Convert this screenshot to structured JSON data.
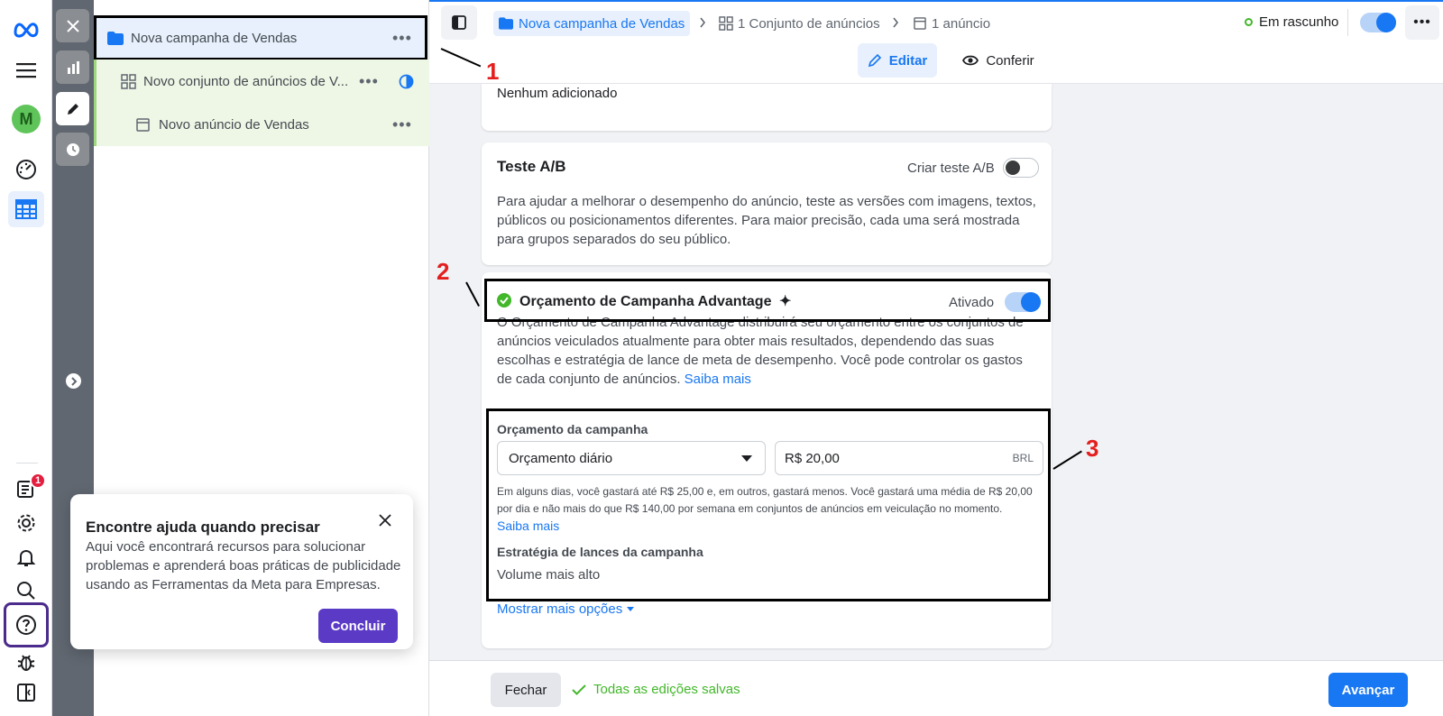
{
  "breadcrumb": {
    "campaign": "Nova campanha de Vendas",
    "adset": "1 Conjunto de anúncios",
    "ad": "1 anúncio"
  },
  "status": {
    "label": "Em rascunho",
    "toggle_on": true
  },
  "mode_tabs": {
    "edit": "Editar",
    "review": "Conferir"
  },
  "tree": {
    "campaign": "Nova campanha de Vendas",
    "adset": "Novo conjunto de anúncios de V...",
    "ad": "Novo anúncio de Vendas"
  },
  "prev_section": {
    "text": "Nenhum adicionado"
  },
  "ab_test": {
    "title": "Teste A/B",
    "toggle_label": "Criar teste A/B",
    "toggle_on": false,
    "description": "Para ajudar a melhorar o desempenho do anúncio, teste as versões com imagens, textos, públicos ou posicionamentos diferentes. Para maior precisão, cada uma será mostrada para grupos separados do seu público."
  },
  "advantage": {
    "title": "Orçamento de Campanha Advantage",
    "sparkle": "✦",
    "toggle_label": "Ativado",
    "toggle_on": true,
    "description": "O Orçamento de Campanha Advantage distribuirá seu orçamento entre os conjuntos de anúncios veiculados atualmente para obter mais resultados, dependendo das suas escolhas e estratégia de lance de meta de desempenho. Você pode controlar os gastos de cada conjunto de anúncios.",
    "learn_more": "Saiba mais"
  },
  "budget": {
    "label": "Orçamento da campanha",
    "type": "Orçamento diário",
    "amount": "R$ 20,00",
    "currency": "BRL",
    "note": "Em alguns dias, você gastará até R$ 25,00 e, em outros, gastará menos. Você gastará uma média de R$ 20,00 por dia e não mais do que R$ 140,00 por semana em conjuntos de anúncios em veiculação no momento.",
    "learn_more": "Saiba mais",
    "bid_label": "Estratégia de lances da campanha",
    "bid_value": "Volume mais alto",
    "more_options": "Mostrar mais opções"
  },
  "annotations": [
    "1",
    "2",
    "3"
  ],
  "footer": {
    "close": "Fechar",
    "saved": "Todas as edições salvas",
    "next": "Avançar"
  },
  "help_popover": {
    "title": "Encontre ajuda quando precisar",
    "body": "Aqui você encontrará recursos para solucionar problemas e aprenderá boas práticas de publicidade usando as Ferramentas da Meta para Empresas.",
    "done": "Concluir"
  },
  "rail": {
    "avatar_letter": "M",
    "notification_count": "1"
  },
  "colors": {
    "accent": "#1877f2",
    "success": "#42b72a",
    "annotation": "#e41e1e",
    "help_button": "#5b3ac6"
  }
}
